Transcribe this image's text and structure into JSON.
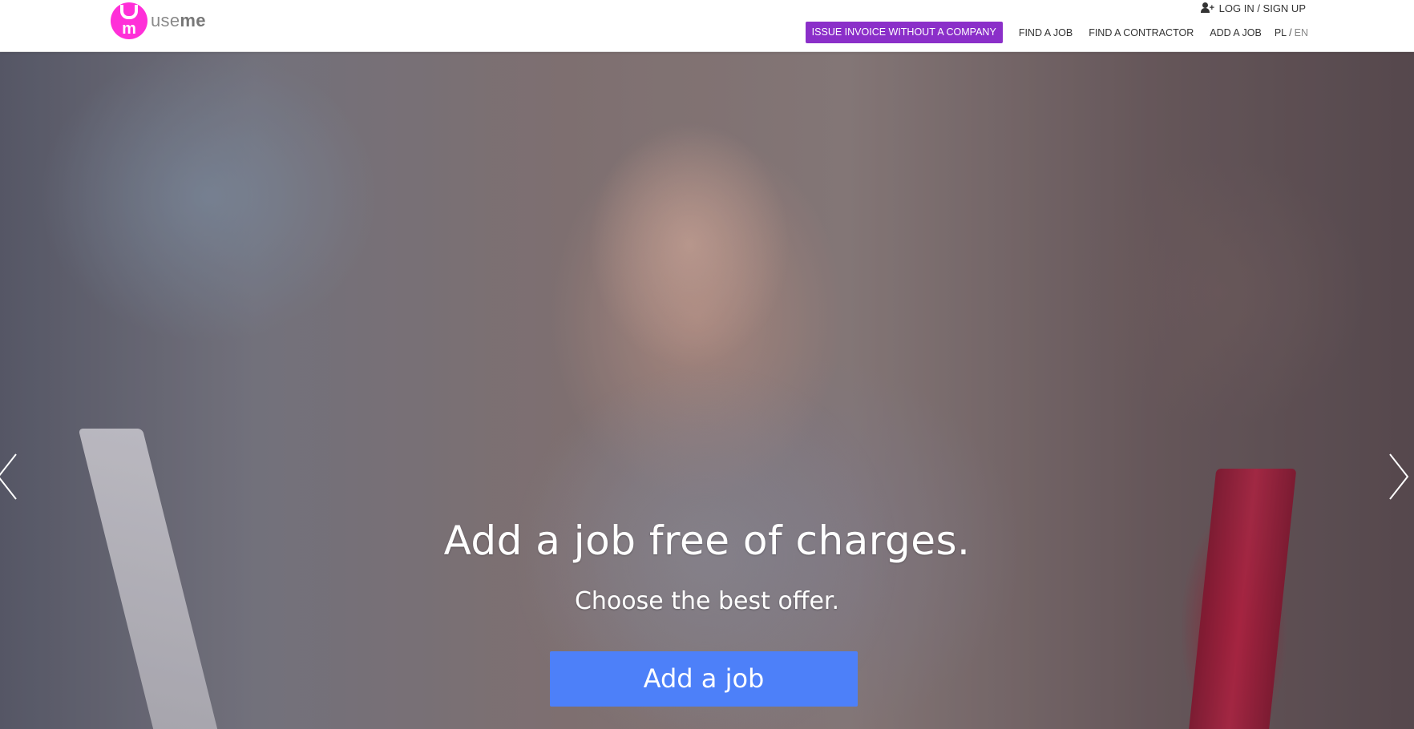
{
  "brand": {
    "name_prefix": "use",
    "name_suffix": "me",
    "logo_color": "#ff2fd8"
  },
  "header": {
    "login_label": "LOG IN / SIGN UP",
    "nav": {
      "invoice_button": "ISSUE INVOICE WITHOUT A COMPANY",
      "find_job": "FIND A JOB",
      "find_contractor": "FIND A CONTRACTOR",
      "add_job": "ADD A JOB",
      "lang_pl": "PL",
      "lang_sep": "/",
      "lang_en": "EN"
    },
    "invoice_color": "#8b2fc9"
  },
  "hero": {
    "headline": "Add a job free of charges.",
    "subline": "Choose the best offer.",
    "cta_label": "Add a job",
    "cta_color": "#4d80f9",
    "icons": {
      "prev": "chevron-left-icon",
      "next": "chevron-right-icon"
    }
  }
}
